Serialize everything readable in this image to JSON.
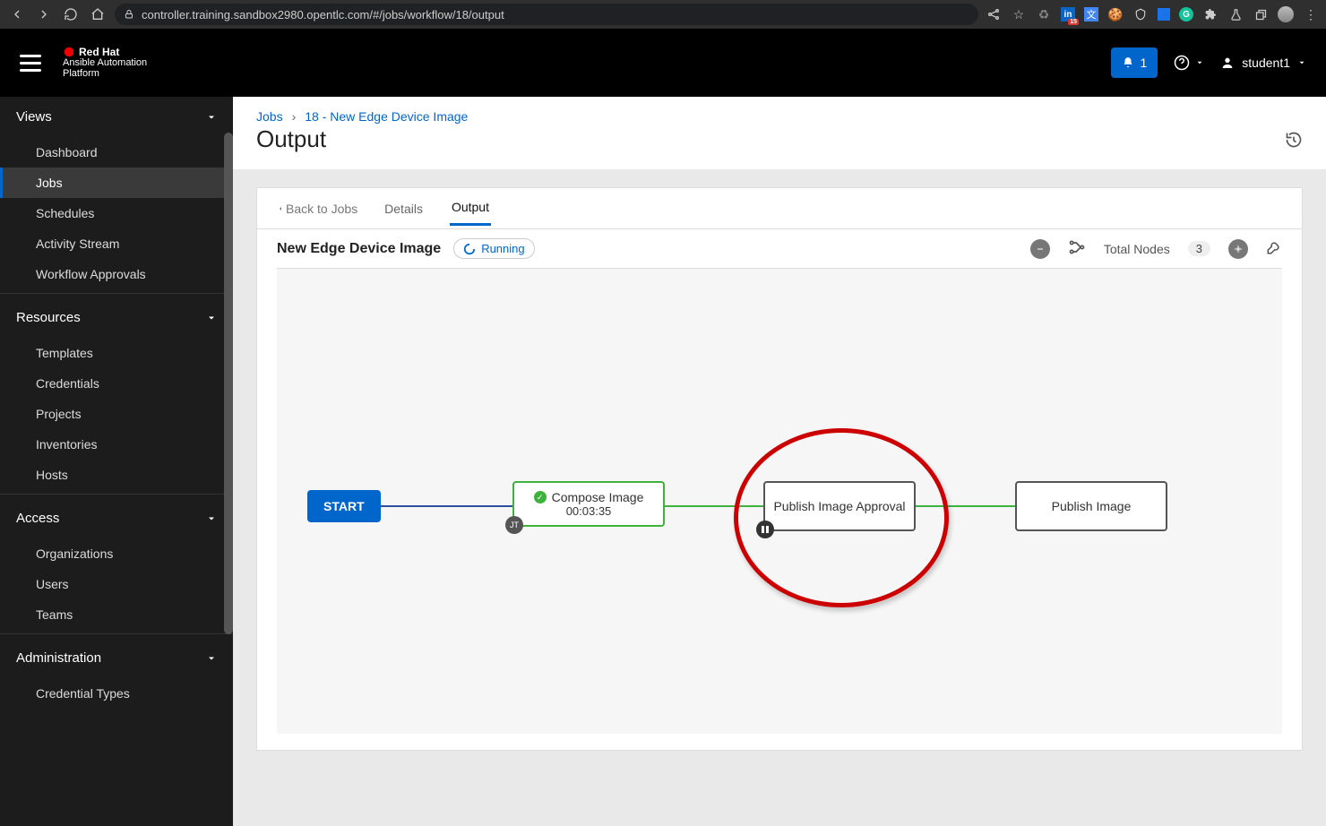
{
  "browser": {
    "url": "controller.training.sandbox2980.opentlc.com/#/jobs/workflow/18/output"
  },
  "brand": {
    "hat": "Red Hat",
    "line2": "Ansible Automation",
    "line3": "Platform"
  },
  "notifications": {
    "count": "1"
  },
  "user": {
    "name": "student1"
  },
  "sidebar": {
    "sections": [
      {
        "title": "Views",
        "items": [
          "Dashboard",
          "Jobs",
          "Schedules",
          "Activity Stream",
          "Workflow Approvals"
        ],
        "activeIndex": 1
      },
      {
        "title": "Resources",
        "items": [
          "Templates",
          "Credentials",
          "Projects",
          "Inventories",
          "Hosts"
        ]
      },
      {
        "title": "Access",
        "items": [
          "Organizations",
          "Users",
          "Teams"
        ]
      },
      {
        "title": "Administration",
        "items": [
          "Credential Types"
        ]
      }
    ]
  },
  "breadcrumbs": {
    "root": "Jobs",
    "current": "18 - New Edge Device Image"
  },
  "page_title": "Output",
  "tabs": {
    "back": "Back to Jobs",
    "details": "Details",
    "output": "Output"
  },
  "job": {
    "name": "New Edge Device Image",
    "status": "Running",
    "total_nodes_label": "Total Nodes",
    "total_nodes_count": "3"
  },
  "workflow": {
    "start_label": "START",
    "nodes": [
      {
        "label": "Compose Image",
        "elapsed": "00:03:35",
        "badge": "JT"
      },
      {
        "label": "Publish Image Approval"
      },
      {
        "label": "Publish Image"
      }
    ]
  }
}
